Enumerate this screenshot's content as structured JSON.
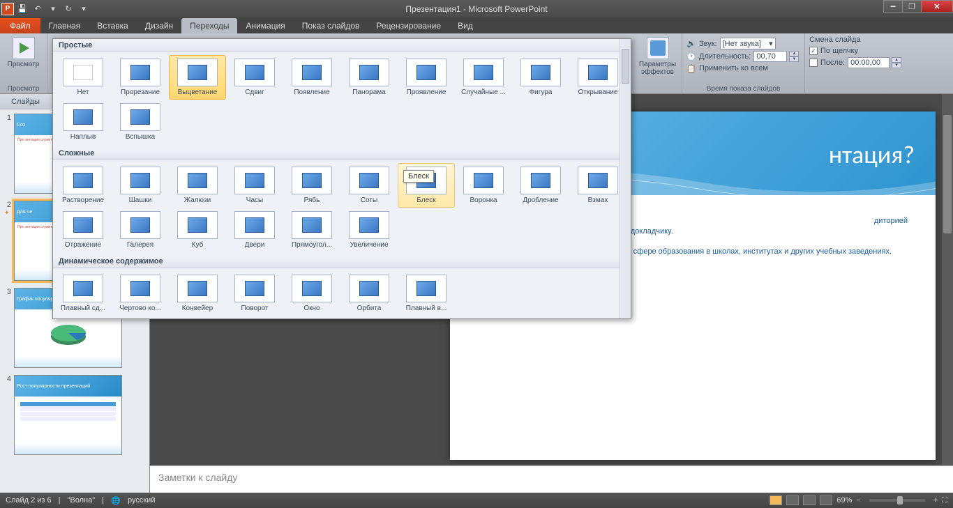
{
  "titlebar": {
    "title": "Презентация1 - Microsoft PowerPoint",
    "app_letter": "P"
  },
  "qat": {
    "save": "💾",
    "undo": "↶",
    "redo": "↷",
    "repeat": "↻"
  },
  "tabs": {
    "file": "Файл",
    "home": "Главная",
    "insert": "Вставка",
    "design": "Дизайн",
    "transitions": "Переходы",
    "animations": "Анимация",
    "slideshow": "Показ слайдов",
    "review": "Рецензирование",
    "view": "Вид"
  },
  "ribbon": {
    "preview_btn": "Просмотр",
    "preview_group": "Просмотр",
    "effect_options": "Параметры эффектов",
    "sound_label": "Звук:",
    "sound_value": "[Нет звука]",
    "duration_label": "Длительность:",
    "duration_value": "00,70",
    "apply_all": "Применить ко всем",
    "timing_group": "Время показа слайдов",
    "advance_title": "Смена слайда",
    "on_click": "По щелчку",
    "after_label": "После:",
    "after_value": "00:00,00"
  },
  "gallery": {
    "section_simple": "Простые",
    "section_complex": "Сложные",
    "section_dynamic": "Динамическое содержимое",
    "simple": [
      "Нет",
      "Прорезание",
      "Выцветание",
      "Сдвиг",
      "Появление",
      "Панорама",
      "Проявление",
      "Случайные ...",
      "Фигура",
      "Открывание",
      "Наплыв",
      "Вспышка"
    ],
    "complex": [
      "Растворение",
      "Шашки",
      "Жалюзи",
      "Часы",
      "Рябь",
      "Соты",
      "Блеск",
      "Воронка",
      "Дробление",
      "Взмах",
      "Отражение",
      "Галерея",
      "Куб",
      "Двери",
      "Прямоугол...",
      "Увеличение"
    ],
    "dynamic": [
      "Плавный сд...",
      "Чертово ко...",
      "Конвейер",
      "Поворот",
      "Окно",
      "Орбита",
      "Плавный в..."
    ],
    "selected": "Выцветание",
    "hover": "Блеск",
    "tooltip": "Блеск"
  },
  "panel": {
    "tab_slides": "Слайды"
  },
  "thumbs": [
    {
      "num": "1",
      "title": "Соз"
    },
    {
      "num": "2",
      "title": "Для че"
    },
    {
      "num": "3",
      "title": "График популярности презентаций"
    },
    {
      "num": "4",
      "title": "Рост популярности презентаций"
    }
  ],
  "slide": {
    "title_fragment": "нтация?",
    "line1_frag": "диторией",
    "line2": "раскрываемой темы и служит шпаргалкой докладчику.",
    "bullet2": "Применяются не только в бизнесе, но и сфере образования в школах, институтах и других учебных заведениях."
  },
  "notes_placeholder": "Заметки к слайду",
  "status": {
    "slide_info": "Слайд 2 из 6",
    "theme": "\"Волна\"",
    "lang": "русский",
    "zoom": "69%"
  }
}
